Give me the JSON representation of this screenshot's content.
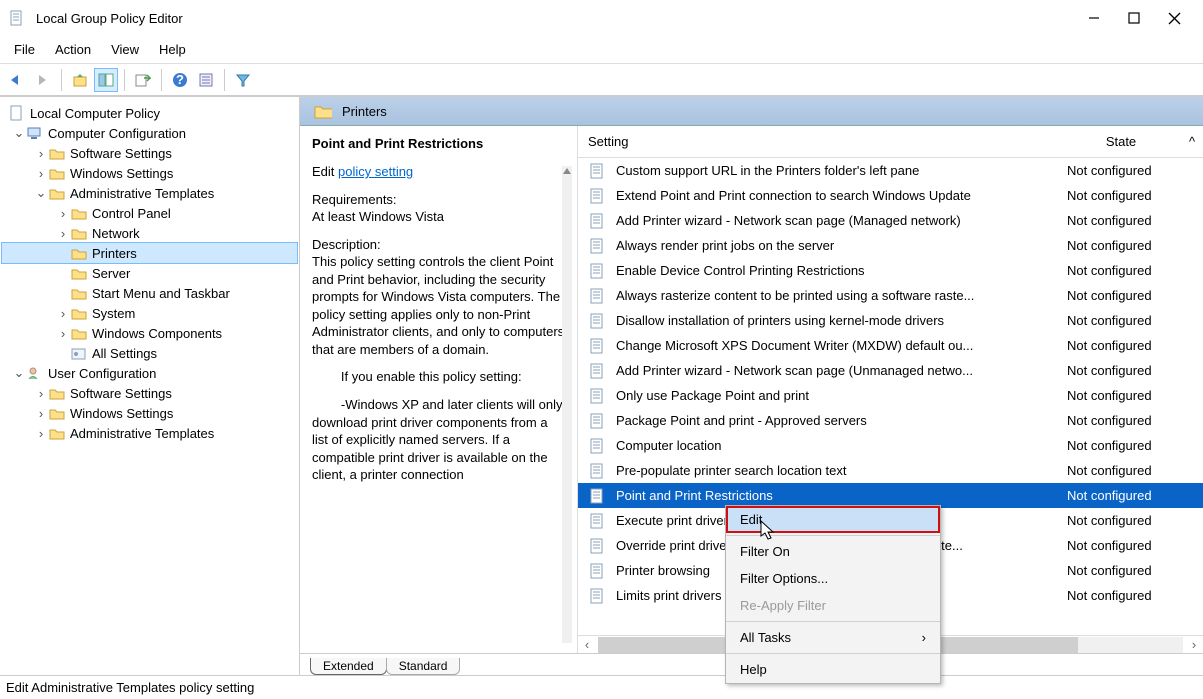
{
  "window": {
    "title": "Local Group Policy Editor"
  },
  "menubar": [
    "File",
    "Action",
    "View",
    "Help"
  ],
  "tree": {
    "root": "Local Computer Policy",
    "cc": "Computer Configuration",
    "uc": "User Configuration",
    "cc_children": [
      "Software Settings",
      "Windows Settings",
      "Administrative Templates"
    ],
    "at_children": [
      "Control Panel",
      "Network",
      "Printers",
      "Server",
      "Start Menu and Taskbar",
      "System",
      "Windows Components",
      "All Settings"
    ],
    "uc_children": [
      "Software Settings",
      "Windows Settings",
      "Administrative Templates"
    ]
  },
  "panel": {
    "header": "Printers",
    "title": "Point and Print Restrictions",
    "edit_prefix": "Edit ",
    "edit_link": "policy setting",
    "req_label": "Requirements:",
    "req_body": "At least Windows Vista",
    "desc_label": "Description:",
    "desc_body": "This policy setting controls the client Point and Print behavior, including the security prompts for Windows Vista computers. The policy setting applies only to non-Print Administrator clients, and only to computers that are members of a domain.",
    "desc_extra1": "        If you enable this policy setting:",
    "desc_extra2": "        -Windows XP and later clients will only download print driver components from a list of explicitly named servers. If a compatible print driver is available on the client, a printer connection"
  },
  "list": {
    "col_setting": "Setting",
    "col_state": "State",
    "scroll_caret": "^",
    "items": [
      {
        "name": "Custom support URL in the Printers folder's left pane",
        "state": "Not configured"
      },
      {
        "name": "Extend Point and Print connection to search Windows Update",
        "state": "Not configured"
      },
      {
        "name": "Add Printer wizard - Network scan page (Managed network)",
        "state": "Not configured"
      },
      {
        "name": "Always render print jobs on the server",
        "state": "Not configured"
      },
      {
        "name": "Enable Device Control Printing Restrictions",
        "state": "Not configured"
      },
      {
        "name": "Always rasterize content to be printed using a software raste...",
        "state": "Not configured"
      },
      {
        "name": "Disallow installation of printers using kernel-mode drivers",
        "state": "Not configured"
      },
      {
        "name": "Change Microsoft XPS Document Writer (MXDW) default ou...",
        "state": "Not configured"
      },
      {
        "name": "Add Printer wizard - Network scan page (Unmanaged netwo...",
        "state": "Not configured"
      },
      {
        "name": "Only use Package Point and print",
        "state": "Not configured"
      },
      {
        "name": "Package Point and print - Approved servers",
        "state": "Not configured"
      },
      {
        "name": "Computer location",
        "state": "Not configured"
      },
      {
        "name": "Pre-populate printer search location text",
        "state": "Not configured"
      },
      {
        "name": "Point and Print Restrictions",
        "state": "Not configured",
        "selected": true
      },
      {
        "name": "Execute print drivers in isolated processes",
        "state": "Not configured"
      },
      {
        "name": "Override print driver execution compatibility setting reporte...",
        "state": "Not configured"
      },
      {
        "name": "Printer browsing",
        "state": "Not configured"
      },
      {
        "name": "Limits print drivers",
        "state": "Not configured"
      }
    ]
  },
  "tabs": {
    "extended": "Extended",
    "standard": "Standard"
  },
  "context_menu": {
    "edit": "Edit",
    "filter_on": "Filter On",
    "filter_options": "Filter Options...",
    "reapply": "Re-Apply Filter",
    "all_tasks": "All Tasks",
    "help": "Help"
  },
  "statusbar": "Edit Administrative Templates policy setting"
}
